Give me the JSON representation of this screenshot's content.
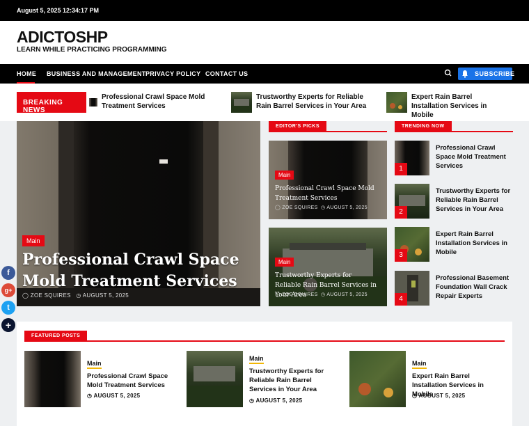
{
  "topbar": {
    "datetime": "August 5, 2025 12:34:17 PM"
  },
  "site": {
    "title": "ADICTOSHP",
    "tagline": "LEARN WHILE PRACTICING PROGRAMMING"
  },
  "nav": {
    "items": [
      "HOME",
      "BUSINESS AND MANAGEMENT",
      "PRIVACY POLICY",
      "CONTACT US"
    ],
    "subscribe": "SUBSCRIBE",
    "search_icon": "search-icon",
    "bell_icon": "bell-icon"
  },
  "breaking": {
    "label": "BREAKING NEWS",
    "items": [
      "Professional Crawl Space Mold Treatment Services",
      "Trustworthy Experts for Reliable Rain Barrel Services in Your Area",
      "Expert Rain Barrel Installation Services in Mobile"
    ]
  },
  "hero": {
    "category": "Main",
    "title": "Professional Crawl Space Mold Treatment Services",
    "author": "ZOE SQUIRES",
    "date": "AUGUST 5, 2025"
  },
  "editors": {
    "heading": "EDITOR'S PICKS",
    "items": [
      {
        "category": "Main",
        "title": "Professional Crawl Space Mold Treatment Services",
        "author": "ZOE SQUIRES",
        "date": "AUGUST 5, 2025"
      },
      {
        "category": "Main",
        "title": "Trustworthy Experts for Reliable Rain Barrel Services in Your Area",
        "author": "ZOE SQUIRES",
        "date": "AUGUST 5, 2025"
      }
    ]
  },
  "trending": {
    "heading": "TRENDING NOW",
    "items": [
      {
        "num": "1",
        "title": "Professional Crawl Space Mold Treatment Services"
      },
      {
        "num": "2",
        "title": "Trustworthy Experts for Reliable Rain Barrel Services in Your Area"
      },
      {
        "num": "3",
        "title": "Expert Rain Barrel Installation Services in Mobile"
      },
      {
        "num": "4",
        "title": "Professional Basement Foundation Wall Crack Repair Experts"
      }
    ]
  },
  "featured": {
    "heading": "FEATURED POSTS",
    "items": [
      {
        "category": "Main",
        "title": "Professional Crawl Space Mold Treatment Services",
        "date": "AUGUST 5, 2025"
      },
      {
        "category": "Main",
        "title": "Trustworthy Experts for Reliable Rain Barrel Services in Your Area",
        "date": "AUGUST 5, 2025"
      },
      {
        "category": "Main",
        "title": "Expert Rain Barrel Installation Services in Mobile",
        "date": "AUGUST 5, 2025"
      }
    ]
  },
  "social": {
    "facebook": "f",
    "googleplus": "g+",
    "twitter": "t",
    "more": "+"
  },
  "colors": {
    "accent": "#e50914",
    "subscribe": "#1a73e8",
    "underline": "#f2b705",
    "facebook": "#3b5998",
    "googleplus": "#dd4b39",
    "twitter": "#1da1f2"
  }
}
